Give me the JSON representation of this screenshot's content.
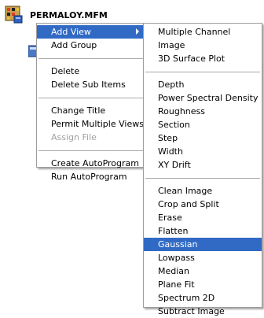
{
  "tree": {
    "file_label": "PERMALOY.MFM"
  },
  "context_menu": {
    "items": [
      {
        "label": "Add View",
        "highlighted": true,
        "has_submenu": true
      },
      {
        "label": "Add Group"
      },
      {
        "separator": true
      },
      {
        "label": "Delete"
      },
      {
        "label": "Delete Sub Items"
      },
      {
        "separator": true
      },
      {
        "label": "Change Title"
      },
      {
        "label": "Permit Multiple Views"
      },
      {
        "label": "Assign File",
        "disabled": true
      },
      {
        "separator": true
      },
      {
        "label": "Create AutoProgram"
      },
      {
        "label": "Run AutoProgram"
      }
    ]
  },
  "submenu": {
    "groups": [
      [
        "Multiple Channel",
        "Image",
        "3D Surface Plot"
      ],
      [
        "Depth",
        "Power Spectral Density",
        "Roughness",
        "Section",
        "Step",
        "Width",
        "XY Drift"
      ],
      [
        "Clean Image",
        "Crop and Split",
        "Erase",
        "Flatten",
        "Gaussian",
        "Lowpass",
        "Median",
        "Plane Fit",
        "Spectrum 2D",
        "Subtract Image"
      ]
    ],
    "highlighted": "Gaussian"
  },
  "colors": {
    "highlight": "#316ac5",
    "disabled_text": "#a0a0a0"
  }
}
